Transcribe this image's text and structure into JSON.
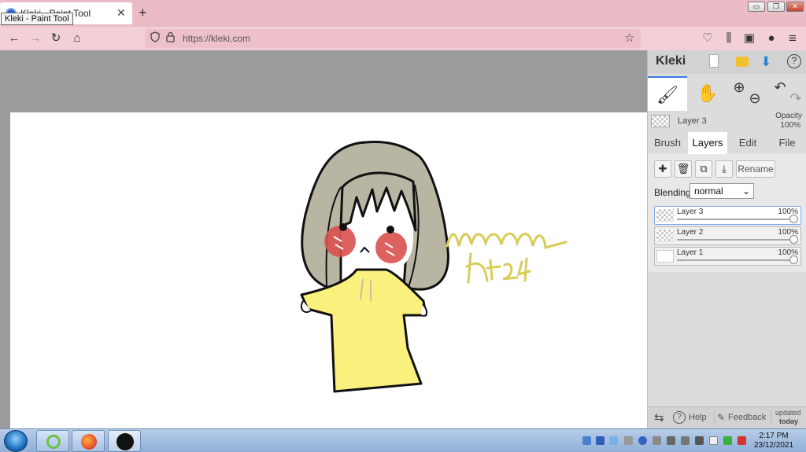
{
  "browser": {
    "tab_title": "Kleki - Paint Tool",
    "tooltip": "Kleki - Paint Tool",
    "tab_close": "✕",
    "new_tab": "+",
    "url": "https://kleki.com",
    "win_minimize": "▭",
    "win_restore": "❐",
    "win_close": "✕"
  },
  "nav": {
    "back": "←",
    "forward": "→",
    "reload": "↻",
    "home": "⌂",
    "bookmark_star": "☆",
    "pocket": "♡",
    "library": "⫼",
    "sidebar": "▣",
    "account": "●",
    "menu": "≡"
  },
  "canvas": {
    "signature_line1": "nhimiathy",
    "signature_line2": "ht247"
  },
  "kleki": {
    "logo": "Kleki",
    "top_icons": [
      "new",
      "import",
      "download",
      "help"
    ],
    "help_glyph": "?",
    "download_glyph": "⬇",
    "tools": {
      "brush_glyph": "🖌",
      "hand_glyph": "✋",
      "zoom_in_glyph": "⊕",
      "zoom_out_glyph": "⊖",
      "undo_glyph": "↶",
      "redo_glyph": "↷"
    },
    "current_layer": "Layer 3",
    "opacity_label": "Opacity",
    "opacity_value": "100%",
    "tabs": [
      "Brush",
      "Layers",
      "Edit",
      "File"
    ],
    "active_tab": "Layers",
    "layer_actions": {
      "add_glyph": "✚",
      "delete_glyph": "🗑",
      "duplicate_glyph": "⧉",
      "merge_glyph": "⤓",
      "rename": "Rename"
    },
    "blending_label": "Blending",
    "blending_value": "normal",
    "layers": [
      {
        "name": "Layer 3",
        "opacity": "100%",
        "selected": true
      },
      {
        "name": "Layer 2",
        "opacity": "100%",
        "selected": false
      },
      {
        "name": "Layer 1",
        "opacity": "100%",
        "selected": false
      }
    ],
    "footer": {
      "swap_glyph": "⇆",
      "help": "Help",
      "feedback": "Feedback",
      "updated_line1": "updated",
      "updated_line2": "today"
    }
  },
  "taskbar": {
    "clock_time": "2:17 PM",
    "clock_date": "23/12/2021"
  },
  "colors": {
    "tab_bar": "#ecbcc6",
    "nav_bar": "#f3d0d6",
    "hair": "#b8b5a2",
    "dress": "#faf07e",
    "blush": "#d9504e",
    "signature": "#d8cc58",
    "accent": "#3d7be0"
  }
}
